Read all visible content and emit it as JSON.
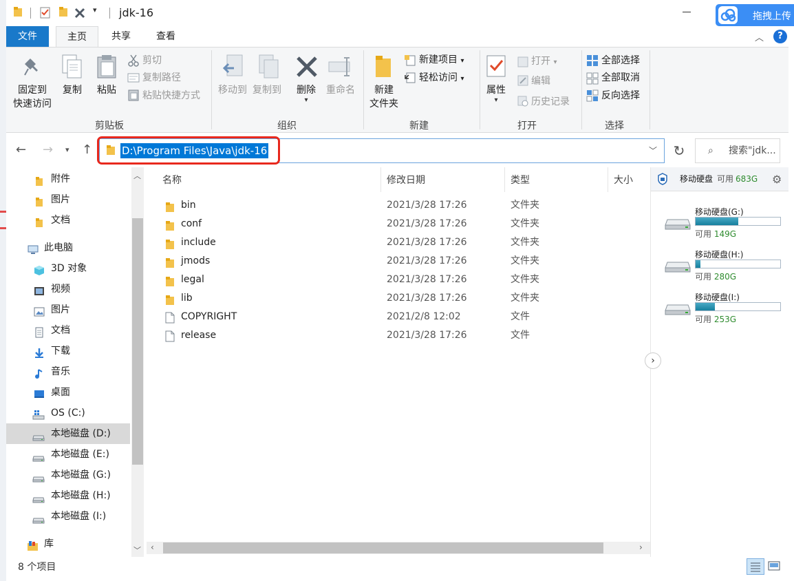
{
  "window": {
    "title": "jdk-16",
    "upload_label": "拖拽上传"
  },
  "ribbon_tabs": [
    {
      "label": "文件"
    },
    {
      "label": "主页"
    },
    {
      "label": "共享"
    },
    {
      "label": "查看"
    }
  ],
  "ribbon": {
    "clipboard": {
      "label": "剪贴板",
      "pin": "固定到\n快速访问",
      "pin_line1": "固定到",
      "pin_line2": "快速访问",
      "copy": "复制",
      "paste": "粘贴",
      "cut": "剪切",
      "copy_path": "复制路径",
      "paste_shortcut": "粘贴快捷方式"
    },
    "organize": {
      "label": "组织",
      "move_to": "移动到",
      "copy_to": "复制到",
      "delete": "删除",
      "rename": "重命名"
    },
    "new": {
      "label": "新建",
      "new_folder_line1": "新建",
      "new_folder_line2": "文件夹",
      "new_item": "新建项目",
      "easy_access": "轻松访问"
    },
    "open": {
      "label": "打开",
      "properties": "属性",
      "open": "打开",
      "edit": "编辑",
      "history": "历史记录"
    },
    "select": {
      "label": "选择",
      "select_all": "全部选择",
      "select_none": "全部取消",
      "invert": "反向选择"
    }
  },
  "address": {
    "path": "D:\\Program Files\\Java\\jdk-16",
    "search_placeholder": "搜索\"jdk..."
  },
  "nav_pane": {
    "items": [
      {
        "label": "附件",
        "icon": "folder-icon"
      },
      {
        "label": "图片",
        "icon": "folder-icon"
      },
      {
        "label": "文档",
        "icon": "folder-icon"
      },
      {
        "label": "此电脑",
        "icon": "computer-icon"
      },
      {
        "label": "3D 对象",
        "icon": "cube-icon"
      },
      {
        "label": "视频",
        "icon": "video-icon"
      },
      {
        "label": "图片",
        "icon": "pictures-icon"
      },
      {
        "label": "文档",
        "icon": "documents-icon"
      },
      {
        "label": "下载",
        "icon": "download-icon"
      },
      {
        "label": "音乐",
        "icon": "music-icon"
      },
      {
        "label": "桌面",
        "icon": "desktop-icon"
      },
      {
        "label": "OS (C:)",
        "icon": "windows-drive-icon"
      },
      {
        "label": "本地磁盘 (D:)",
        "icon": "drive-icon",
        "selected": true
      },
      {
        "label": "本地磁盘 (E:)",
        "icon": "drive-icon"
      },
      {
        "label": "本地磁盘 (G:)",
        "icon": "drive-icon"
      },
      {
        "label": "本地磁盘 (H:)",
        "icon": "drive-icon"
      },
      {
        "label": "本地磁盘 (I:)",
        "icon": "drive-icon"
      },
      {
        "label": "库",
        "icon": "library-icon"
      }
    ]
  },
  "file_list": {
    "columns": {
      "name": "名称",
      "modified": "修改日期",
      "type": "类型",
      "size": "大小"
    },
    "rows": [
      {
        "name": "bin",
        "modified": "2021/3/28 17:26",
        "type": "文件夹",
        "kind": "folder"
      },
      {
        "name": "conf",
        "modified": "2021/3/28 17:26",
        "type": "文件夹",
        "kind": "folder"
      },
      {
        "name": "include",
        "modified": "2021/3/28 17:26",
        "type": "文件夹",
        "kind": "folder"
      },
      {
        "name": "jmods",
        "modified": "2021/3/28 17:26",
        "type": "文件夹",
        "kind": "folder"
      },
      {
        "name": "legal",
        "modified": "2021/3/28 17:26",
        "type": "文件夹",
        "kind": "folder"
      },
      {
        "name": "lib",
        "modified": "2021/3/28 17:26",
        "type": "文件夹",
        "kind": "folder"
      },
      {
        "name": "COPYRIGHT",
        "modified": "2021/2/8 12:02",
        "type": "文件",
        "kind": "file"
      },
      {
        "name": "release",
        "modified": "2021/3/28 17:26",
        "type": "文件",
        "kind": "file"
      }
    ]
  },
  "drive_panel": {
    "header_title": "移动硬盘",
    "header_free_label": "可用",
    "header_free_value": "683G",
    "drives": [
      {
        "name": "移动硬盘(G:)",
        "free_label": "可用",
        "free_value": "149G",
        "used_fraction": 0.5
      },
      {
        "name": "移动硬盘(H:)",
        "free_label": "可用",
        "free_value": "280G",
        "used_fraction": 0.06
      },
      {
        "name": "移动硬盘(I:)",
        "free_label": "可用",
        "free_value": "253G",
        "used_fraction": 0.23
      }
    ]
  },
  "status": {
    "item_count": "8 个项目"
  },
  "colors": {
    "accent": "#1979ca",
    "selection": "#0078d7",
    "annotation_red": "#e8281d"
  }
}
